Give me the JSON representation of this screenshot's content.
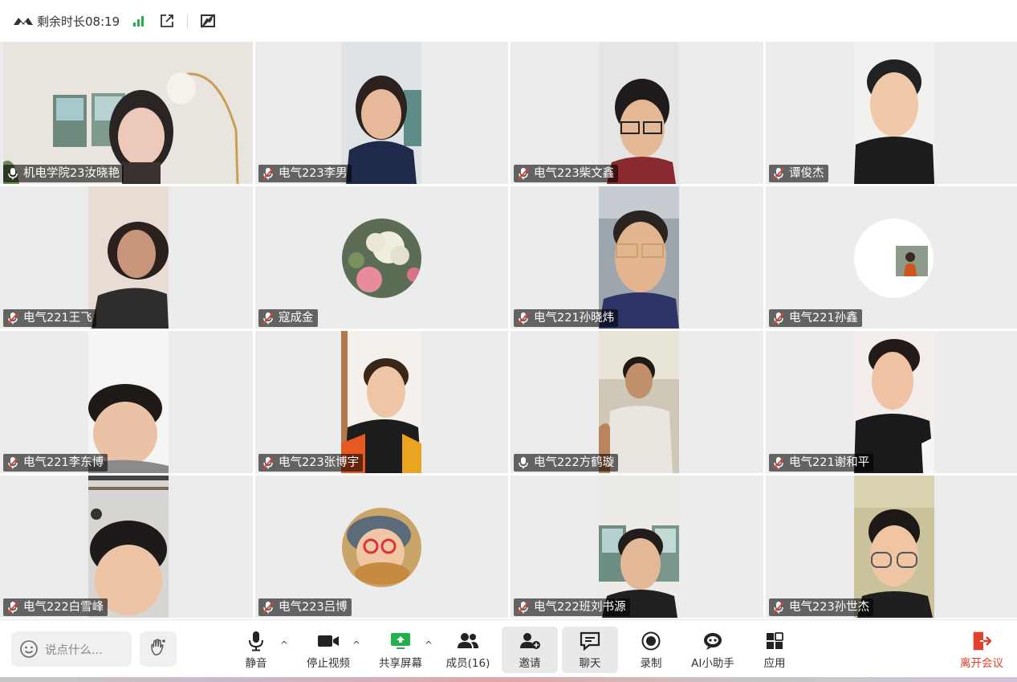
{
  "topbar": {
    "remaining_time": "剩余时长08:19",
    "icons": [
      "meeting-logo-icon",
      "signal-icon",
      "popout-icon",
      "annotation-off-icon"
    ]
  },
  "participants": [
    {
      "name": "机电学院23汝晓艳",
      "mic": "on",
      "view": "video"
    },
    {
      "name": "电气223李男",
      "mic": "muted",
      "view": "video"
    },
    {
      "name": "电气223柴文鑫",
      "mic": "muted",
      "view": "video"
    },
    {
      "name": "谭俊杰",
      "mic": "muted",
      "view": "video"
    },
    {
      "name": "电气221王飞",
      "mic": "muted",
      "view": "video"
    },
    {
      "name": "寇成金",
      "mic": "muted",
      "view": "avatar"
    },
    {
      "name": "电气221孙晓炜",
      "mic": "muted",
      "view": "video"
    },
    {
      "name": "电气221孙鑫",
      "mic": "muted",
      "view": "avatar"
    },
    {
      "name": "电气221李东博",
      "mic": "muted",
      "view": "video"
    },
    {
      "name": "电气223张博宇",
      "mic": "muted",
      "view": "video"
    },
    {
      "name": "电气222方鹤璇",
      "mic": "on",
      "view": "video"
    },
    {
      "name": "电气221谢和平",
      "mic": "muted",
      "view": "video"
    },
    {
      "name": "电气222白雪峰",
      "mic": "muted",
      "view": "video"
    },
    {
      "name": "电气223吕博",
      "mic": "muted",
      "view": "avatar"
    },
    {
      "name": "电气222班刘书源",
      "mic": "muted",
      "view": "video"
    },
    {
      "name": "电气223孙世杰",
      "mic": "muted",
      "view": "video"
    }
  ],
  "toolbar": {
    "chat_placeholder": "说点什么...",
    "mute_label": "静音",
    "stop_video_label": "停止视频",
    "share_screen_label": "共享屏幕",
    "members_label": "成员(16)",
    "invite_label": "邀请",
    "chat_label": "聊天",
    "record_label": "录制",
    "ai_assistant_label": "AI小助手",
    "apps_label": "应用",
    "leave_label": "离开会议"
  },
  "colors": {
    "leave": "#e2402b",
    "signal": "#22b14c",
    "share": "#22b14c",
    "tile_bg": "#ececec"
  }
}
